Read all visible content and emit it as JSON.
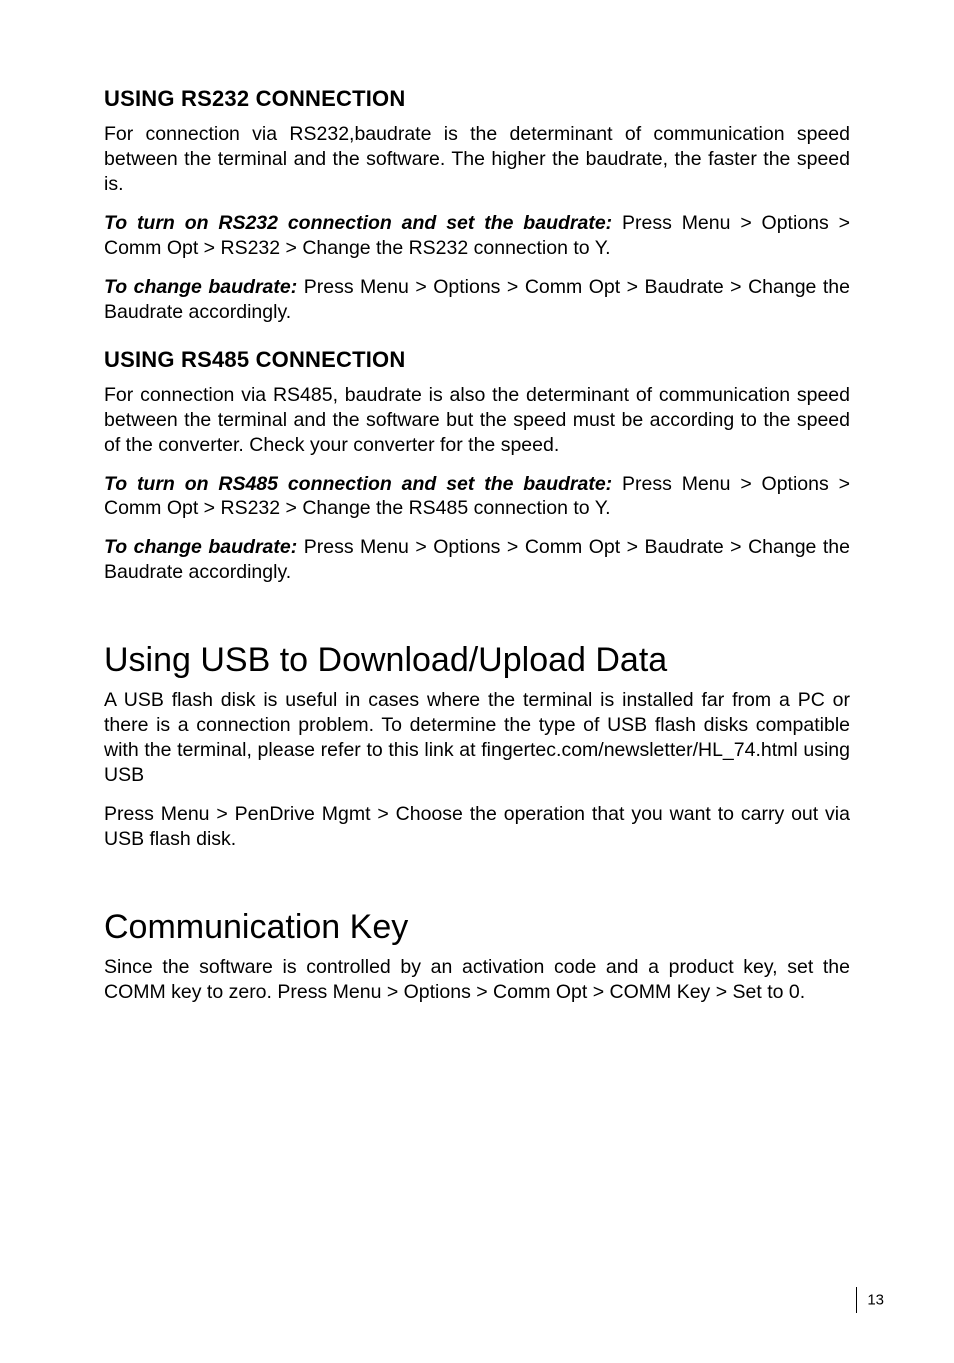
{
  "sec1": {
    "heading": "USING RS232 CONNECTION",
    "p1": "For connection via RS232,baudrate is the determinant of communication speed between the terminal and the software. The higher the baudrate, the faster the speed is.",
    "p2a": "To turn on RS232 connection and set the baudrate:",
    "p2b": " Press Menu > Options > Comm Opt > RS232 > Change the RS232 connection to Y.",
    "p3a": "To change baudrate:",
    "p3b": " Press Menu > Options > Comm Opt > Baudrate > Change the Baudrate accordingly."
  },
  "sec2": {
    "heading": "USING RS485 CONNECTION",
    "p1": "For connection via RS485, baudrate is also the determinant of communication speed between the terminal and the software but the speed must be according to the speed of the converter. Check your converter for the speed.",
    "p2a": "To turn on RS485 connection and set the baudrate:",
    "p2b": " Press Menu > Options > Comm Opt > RS232 > Change the RS485 connection to Y.",
    "p3a": "To change baudrate:",
    "p3b": " Press Menu > Options > Comm Opt > Baudrate > Change the Baudrate accordingly."
  },
  "sec3": {
    "heading": "Using USB to Download/Upload Data",
    "p1": "A USB flash disk is useful in cases where the terminal is installed far from a PC or there is a connection problem. To determine the type of USB flash disks compatible with the terminal, please refer to this link at fingertec.com/newsletter/HL_74.html using USB",
    "p2": "Press Menu > PenDrive Mgmt > Choose the operation that you want to carry out via USB flash disk."
  },
  "sec4": {
    "heading": "Communication Key",
    "p1": "Since the software is controlled by an activation code and a product key, set the COMM key to zero. Press Menu > Options > Comm Opt > COMM Key > Set to 0."
  },
  "page_number": "13"
}
